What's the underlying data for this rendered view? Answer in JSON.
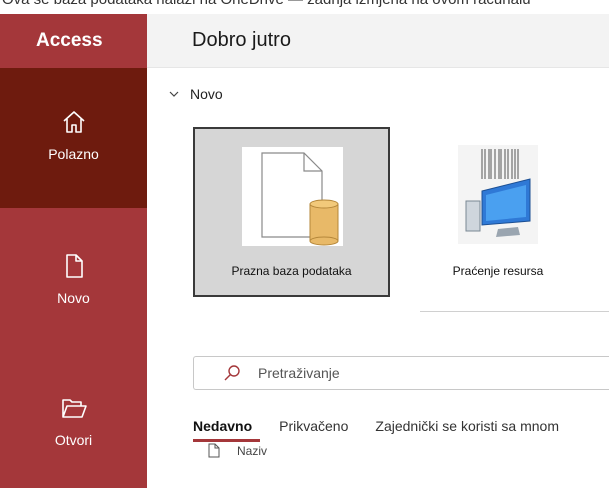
{
  "top_strip_text": "Ova se baza podataka nalazi na OneDrive — zadnja izmjena na ovom računalu",
  "app": {
    "name": "Access"
  },
  "rail": {
    "items": [
      {
        "label": "Polazno",
        "icon": "home-icon",
        "active": true
      },
      {
        "label": "Novo",
        "icon": "new-file-icon",
        "active": false
      },
      {
        "label": "Otvori",
        "icon": "open-folder-icon",
        "active": false
      }
    ]
  },
  "header": {
    "greeting": "Dobro jutro"
  },
  "new_section": {
    "title": "Novo",
    "templates": [
      {
        "label": "Prazna baza podataka",
        "selected": true
      },
      {
        "label": "Praćenje resursa",
        "selected": false
      }
    ]
  },
  "search": {
    "placeholder": "Pretraživanje"
  },
  "tabs": [
    {
      "label": "Nedavno",
      "active": true
    },
    {
      "label": "Prikvačeno",
      "active": false
    },
    {
      "label": "Zajednički se koristi sa mnom",
      "active": false
    }
  ],
  "file_list": {
    "column_name": "Naziv"
  },
  "colors": {
    "accent": "#a4373a",
    "rail_active": "#6e1b0e",
    "header_bg": "#f3f3f3"
  }
}
